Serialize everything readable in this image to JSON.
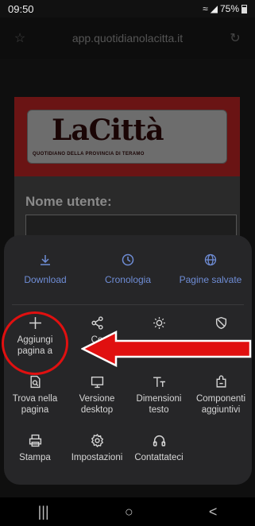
{
  "status": {
    "time": "09:50",
    "battery": "75%"
  },
  "browser": {
    "url": "app.quotidianolacitta.it"
  },
  "site": {
    "logo": "LaCittà",
    "tagline": "QUOTIDIANO DELLA PROVINCIA DI TERAMO",
    "username_label": "Nome utente:"
  },
  "menu": {
    "top": [
      {
        "label": "Download",
        "icon": "download-icon"
      },
      {
        "label": "Cronologia",
        "icon": "clock-icon"
      },
      {
        "label": "Pagine salvate",
        "icon": "globe-icon"
      }
    ],
    "grid": [
      {
        "label": "Aggiungi pagina a",
        "icon": "plus-icon"
      },
      {
        "label": "Co",
        "icon": "share-icon"
      },
      {
        "label": "",
        "icon": "brightness-icon"
      },
      {
        "label": "",
        "icon": "shield-icon"
      },
      {
        "label": "Trova nella pagina",
        "icon": "find-icon"
      },
      {
        "label": "Versione desktop",
        "icon": "desktop-icon"
      },
      {
        "label": "Dimensioni testo",
        "icon": "text-size-icon"
      },
      {
        "label": "Componenti aggiuntivi",
        "icon": "addons-icon"
      },
      {
        "label": "Stampa",
        "icon": "print-icon"
      },
      {
        "label": "Impostazioni",
        "icon": "settings-icon"
      },
      {
        "label": "Contattateci",
        "icon": "headset-icon"
      },
      {
        "label": "",
        "icon": ""
      }
    ]
  },
  "colors": {
    "accent": "#6f8dd6",
    "annotation": "#e01010"
  }
}
